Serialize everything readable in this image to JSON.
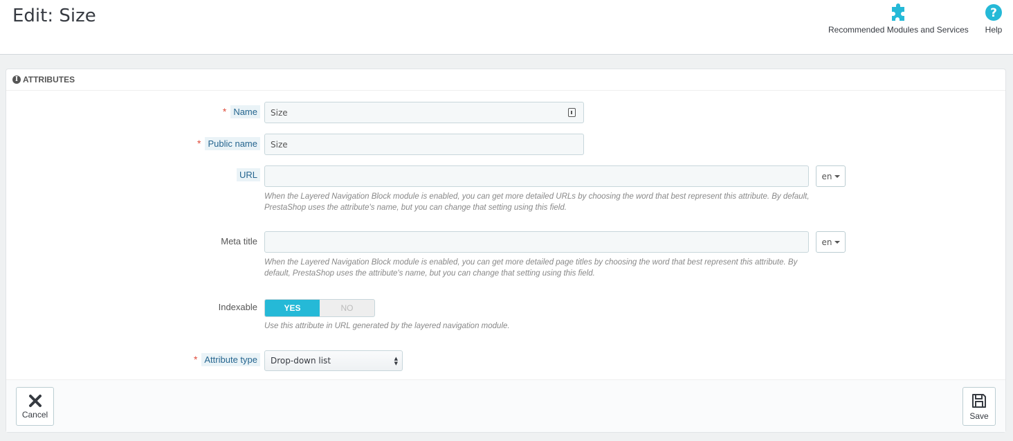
{
  "header": {
    "title": "Edit: Size",
    "toolbar": [
      {
        "label": "Recommended Modules and Services",
        "icon": "puzzle-icon"
      },
      {
        "label": "Help",
        "icon": "help-circle-icon"
      }
    ]
  },
  "panel": {
    "heading": "Attributes",
    "fields": {
      "name": {
        "label": "Name",
        "value": "Size",
        "required": true
      },
      "public_name": {
        "label": "Public name",
        "value": "Size",
        "required": true
      },
      "url": {
        "label": "URL",
        "value": "",
        "lang": "en",
        "help": "When the Layered Navigation Block module is enabled, you can get more detailed URLs by choosing the word that best represent this attribute. By default, PrestaShop uses the attribute's name, but you can change that setting using this field."
      },
      "meta_title": {
        "label": "Meta title",
        "value": "",
        "lang": "en",
        "help": "When the Layered Navigation Block module is enabled, you can get more detailed page titles by choosing the word that best represent this attribute. By default, PrestaShop uses the attribute's name, but you can change that setting using this field."
      },
      "indexable": {
        "label": "Indexable",
        "yes": "YES",
        "no": "NO",
        "selected": "YES",
        "help": "Use this attribute in URL generated by the layered navigation module."
      },
      "attribute_type": {
        "label": "Attribute type",
        "value": "Drop-down list",
        "required": true
      }
    },
    "footer": {
      "cancel": "Cancel",
      "save": "Save"
    }
  },
  "colors": {
    "accent": "#25b9d7",
    "required": "#e04c3b",
    "label_tip": "#25658f"
  }
}
